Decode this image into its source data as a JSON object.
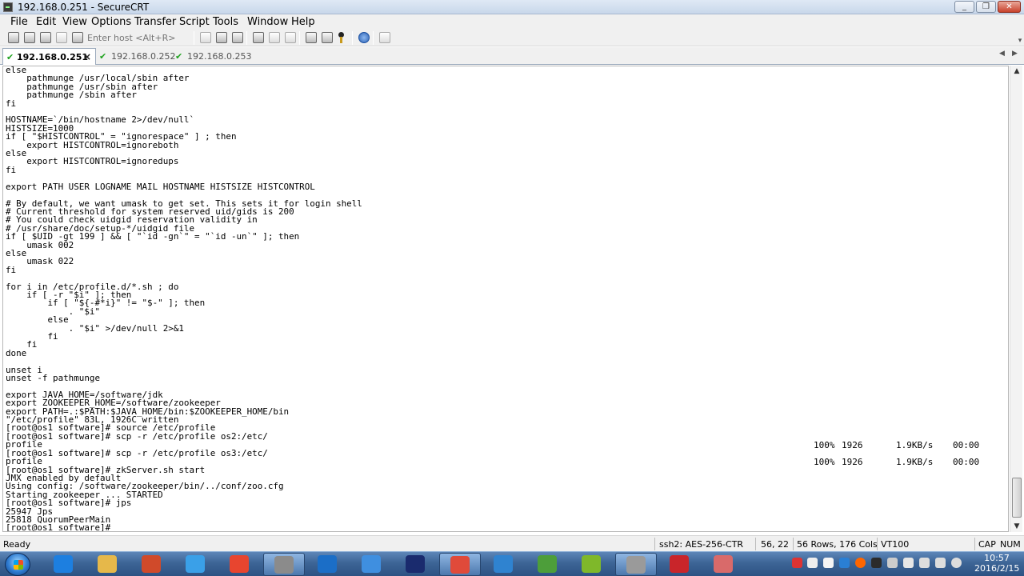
{
  "window": {
    "title": "192.168.0.251 - SecureCRT"
  },
  "menu": [
    "File",
    "Edit",
    "View",
    "Options",
    "Transfer",
    "Script",
    "Tools",
    "Window",
    "Help"
  ],
  "toolbar": {
    "host_placeholder": "Enter host <Alt+R>"
  },
  "tabs": [
    {
      "label": "192.168.0.251",
      "close": "×"
    },
    {
      "label": "192.168.0.252"
    },
    {
      "label": "192.168.0.253"
    }
  ],
  "terminal": {
    "lines": [
      "else",
      "    pathmunge /usr/local/sbin after",
      "    pathmunge /usr/sbin after",
      "    pathmunge /sbin after",
      "fi",
      "",
      "HOSTNAME=`/bin/hostname 2>/dev/null`",
      "HISTSIZE=1000",
      "if [ \"$HISTCONTROL\" = \"ignorespace\" ] ; then",
      "    export HISTCONTROL=ignoreboth",
      "else",
      "    export HISTCONTROL=ignoredups",
      "fi",
      "",
      "export PATH USER LOGNAME MAIL HOSTNAME HISTSIZE HISTCONTROL",
      "",
      "# By default, we want umask to get set. This sets it for login shell",
      "# Current threshold for system reserved uid/gids is 200",
      "# You could check uidgid reservation validity in",
      "# /usr/share/doc/setup-*/uidgid file",
      "if [ $UID -gt 199 ] && [ \"`id -gn`\" = \"`id -un`\" ]; then",
      "    umask 002",
      "else",
      "    umask 022",
      "fi",
      "",
      "for i in /etc/profile.d/*.sh ; do",
      "    if [ -r \"$i\" ]; then",
      "        if [ \"${-#*i}\" != \"$-\" ]; then",
      "            . \"$i\"",
      "        else",
      "            . \"$i\" >/dev/null 2>&1",
      "        fi",
      "    fi",
      "done",
      "",
      "unset i",
      "unset -f pathmunge",
      "",
      "export JAVA_HOME=/software/jdk",
      "export ZOOKEEPER_HOME=/software/zookeeper",
      "export PATH=.:$PATH:$JAVA_HOME/bin:$ZOOKEEPER_HOME/bin",
      "\"/etc/profile\" 83L, 1926C written",
      "[root@os1 software]# source /etc/profile",
      "[root@os1 software]# scp -r /etc/profile os2:/etc/",
      "profile",
      "[root@os1 software]# scp -r /etc/profile os3:/etc/",
      "profile",
      "[root@os1 software]# zkServer.sh start",
      "JMX enabled by default",
      "Using config: /software/zookeeper/bin/../conf/zoo.cfg",
      "Starting zookeeper ... STARTED",
      "[root@os1 software]# jps",
      "25947 Jps",
      "25818 QuorumPeerMain",
      "[root@os1 software]#"
    ],
    "transfers": [
      {
        "percent": "100%",
        "size": "1926",
        "rate": "1.9KB/s",
        "time": "00:00"
      },
      {
        "percent": "100%",
        "size": "1926",
        "rate": "1.9KB/s",
        "time": "00:00"
      }
    ]
  },
  "status": {
    "ready": "Ready",
    "cipher": "ssh2: AES-256-CTR",
    "position": "56,  22",
    "dimensions": "56 Rows, 176 Cols",
    "emulation": "VT100",
    "cap": "CAP",
    "num": "NUM"
  },
  "taskbar": {
    "time": "10:57",
    "date": "2016/2/15",
    "apps": [
      "internet-explorer",
      "file-explorer",
      "media-player",
      "app-blue",
      "chrome",
      "securecrt",
      "network-tool",
      "app-feather",
      "eclipse",
      "app-red",
      "virtualbox",
      "app-p",
      "app-m",
      "app-terminal",
      "app-x",
      "app-pen"
    ]
  }
}
